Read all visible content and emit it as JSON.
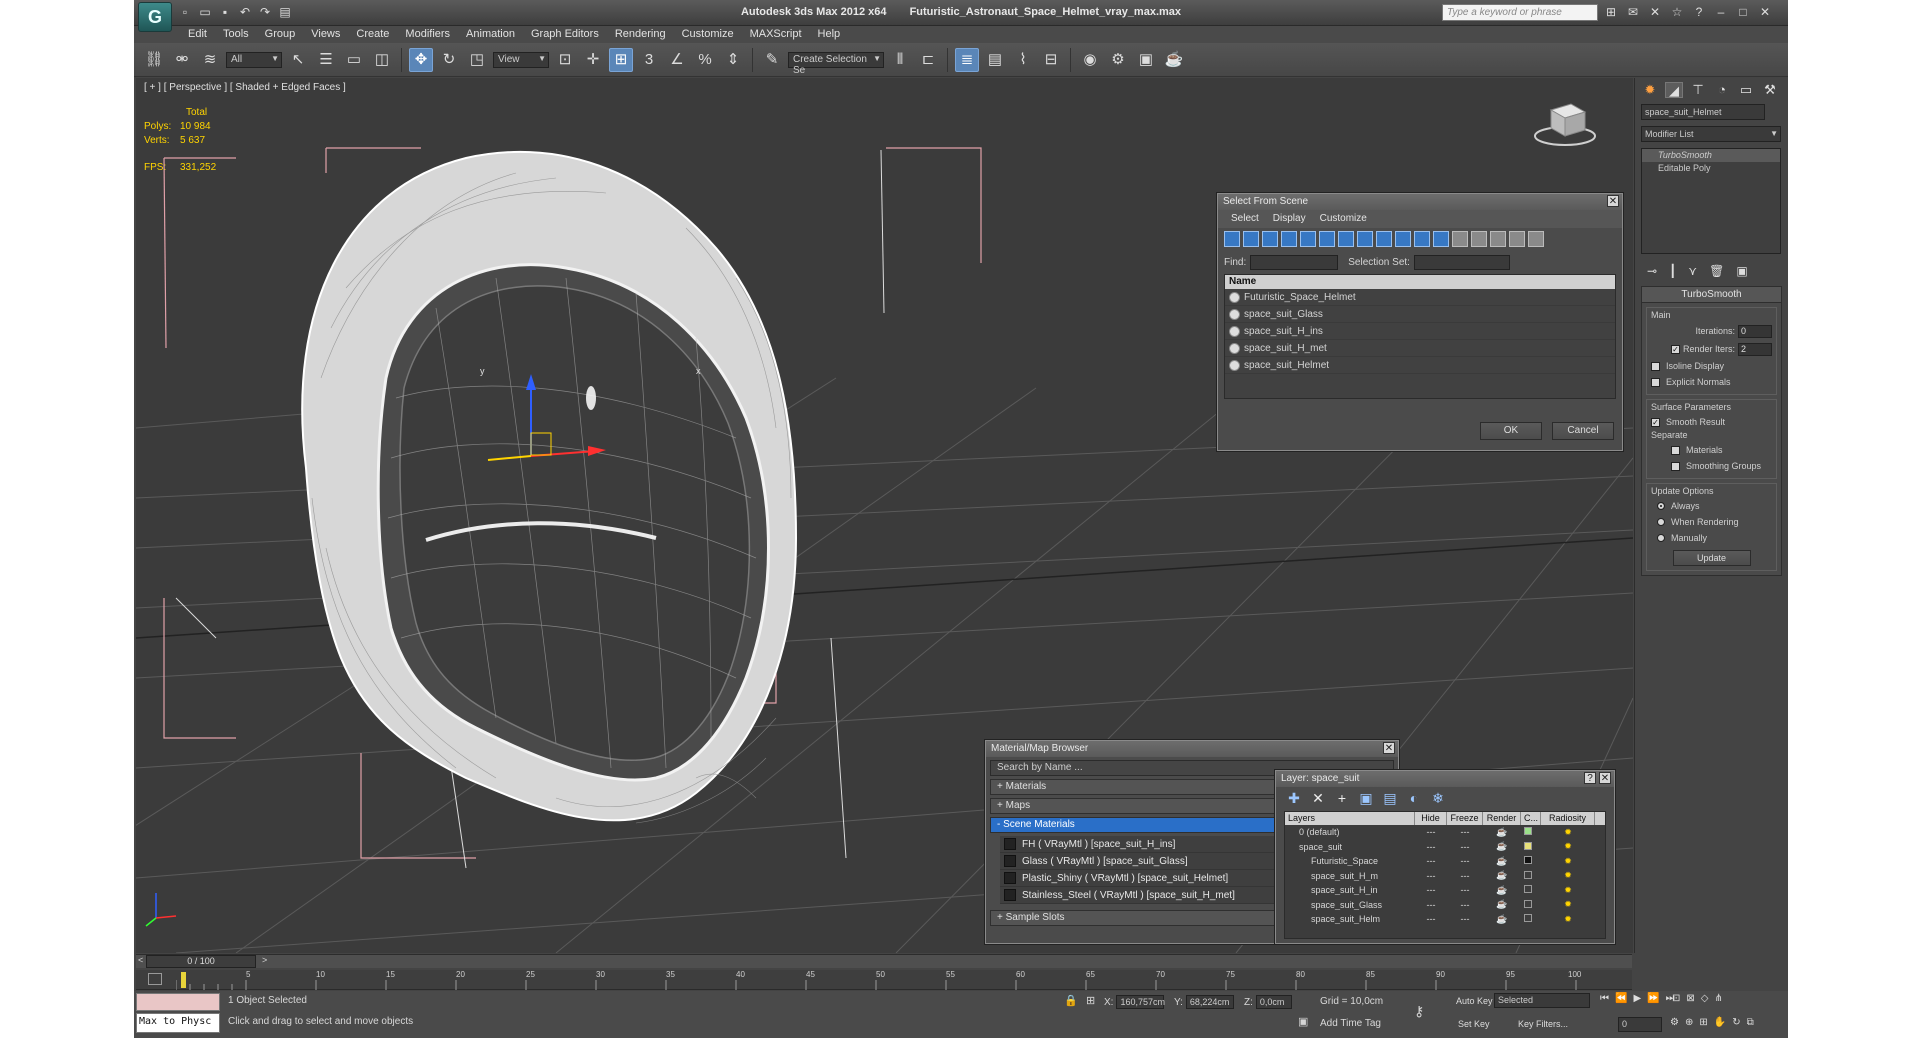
{
  "titlebar": {
    "app": "Autodesk 3ds Max  2012 x64",
    "file": "Futuristic_Astronaut_Space_Helmet_vray_max.max",
    "search_placeholder": "Type a keyword or phrase"
  },
  "menu": [
    "Edit",
    "Tools",
    "Group",
    "Views",
    "Create",
    "Modifiers",
    "Animation",
    "Graph Editors",
    "Rendering",
    "Customize",
    "MAXScript",
    "Help"
  ],
  "toolbar": {
    "filter": "All",
    "ref_coord": "View",
    "selection_set": "Create Selection Se"
  },
  "viewport": {
    "label": "[ + ] [ Perspective ] [ Shaded + Edged Faces ]",
    "stats_header": "Total",
    "polys_label": "Polys:",
    "polys": "10 984",
    "verts_label": "Verts:",
    "verts": "5 637",
    "fps_label": "FPS:",
    "fps": "331,252",
    "axis_x": "x",
    "axis_y": "y"
  },
  "select_from_scene": {
    "title": "Select From Scene",
    "tabs": [
      "Select",
      "Display",
      "Customize"
    ],
    "find_label": "Find:",
    "selection_set_label": "Selection Set:",
    "column": "Name",
    "rows": [
      "Futuristic_Space_Helmet",
      "space_suit_Glass",
      "space_suit_H_ins",
      "space_suit_H_met",
      "space_suit_Helmet"
    ],
    "ok": "OK",
    "cancel": "Cancel"
  },
  "material_browser": {
    "title": "Material/Map Browser",
    "search": "Search by Name ...",
    "materials": "+ Materials",
    "maps": "+ Maps",
    "scene_materials": "- Scene Materials",
    "items": [
      "FH  ( VRayMtl ) [space_suit_H_ins]",
      "Glass  ( VRayMtl ) [space_suit_Glass]",
      "Plastic_Shiny  ( VRayMtl ) [space_suit_Helmet]",
      "Stainless_Steel  ( VRayMtl ) [space_suit_H_met]"
    ],
    "sample_slots": "+ Sample Slots"
  },
  "layer_manager": {
    "title": "Layer: space_suit",
    "columns": [
      "Layers",
      "Hide",
      "Freeze",
      "Render",
      "C...",
      "Radiosity"
    ],
    "rows": [
      {
        "name": "0 (default)",
        "color": "#9be08a"
      },
      {
        "name": "space_suit",
        "color": "#e8e07a"
      },
      {
        "name": "Futuristic_Space",
        "color": "#111111"
      },
      {
        "name": "space_suit_H_m",
        "color": "#3d3d3d"
      },
      {
        "name": "space_suit_H_in",
        "color": "#3d3d3d"
      },
      {
        "name": "space_suit_Glass",
        "color": "#3d3d3d"
      },
      {
        "name": "space_suit_Helm",
        "color": "#3d3d3d"
      }
    ]
  },
  "command_panel": {
    "object_name": "space_suit_Helmet",
    "modifier_list": "Modifier List",
    "stack": [
      "TurboSmooth",
      "Editable Poly"
    ],
    "rollout_title": "TurboSmooth",
    "main_group": "Main",
    "iterations_label": "Iterations:",
    "iterations": "0",
    "render_iters_label": "Render Iters:",
    "render_iters": "2",
    "isoline": "Isoline Display",
    "explicit_normals": "Explicit Normals",
    "surface_params": "Surface Parameters",
    "smooth_result": "Smooth Result",
    "separate": "Separate",
    "materials": "Materials",
    "smoothing_groups": "Smoothing Groups",
    "update_options": "Update Options",
    "always": "Always",
    "when_rendering": "When Rendering",
    "manually": "Manually",
    "update": "Update"
  },
  "timeline": {
    "frame": "0 / 100",
    "ticks": [
      "5",
      "10",
      "15",
      "20",
      "25",
      "30",
      "35",
      "40",
      "45",
      "50",
      "55",
      "60",
      "65",
      "70",
      "75",
      "80",
      "85",
      "90",
      "95",
      "100"
    ]
  },
  "status": {
    "maxscript": "Max to Physc",
    "selected": "1 Object Selected",
    "prompt": "Click and drag to select and move objects",
    "x_label": "X:",
    "x": "160,757cm",
    "y_label": "Y:",
    "y": "68,224cm",
    "z_label": "Z:",
    "z": "0,0cm",
    "grid": "Grid = 10,0cm",
    "add_time_tag": "Add Time Tag",
    "auto_key": "Auto Key",
    "set_key": "Set Key",
    "selected_combo": "Selected",
    "key_filters": "Key Filters...",
    "frame_field": "0"
  }
}
